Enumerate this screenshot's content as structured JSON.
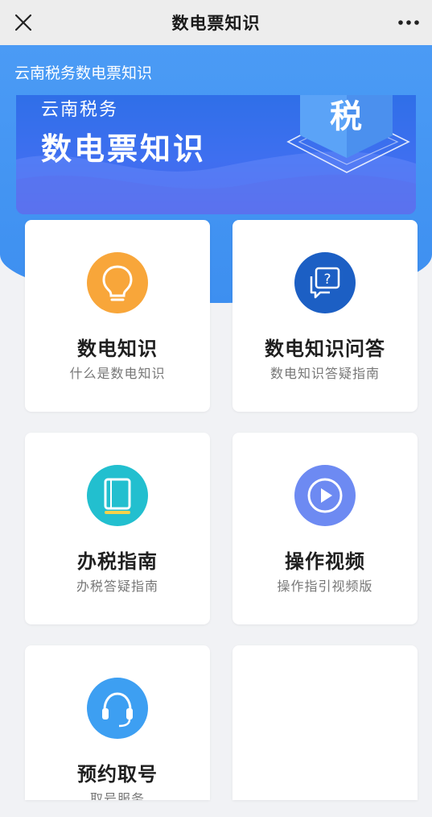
{
  "titlebar": {
    "title": "数电票知识"
  },
  "hero": {
    "heading": "云南税务数电票知识"
  },
  "banner": {
    "subtitle": "云南税务",
    "title": "数电票知识",
    "emblem_text": "税"
  },
  "cards": [
    {
      "title": "数电知识",
      "subtitle": "什么是数电知识",
      "icon": "lightbulb-icon",
      "color": "#f8a63a"
    },
    {
      "title": "数电知识问答",
      "subtitle": "数电知识答疑指南",
      "icon": "question-chat-icon",
      "color": "#1c5fc4"
    },
    {
      "title": "办税指南",
      "subtitle": "办税答疑指南",
      "icon": "book-icon",
      "color": "#22bfcf"
    },
    {
      "title": "操作视频",
      "subtitle": "操作指引视频版",
      "icon": "play-icon",
      "color": "#6d8af2"
    },
    {
      "title": "预约取号",
      "subtitle": "取号服务",
      "icon": "headset-icon",
      "color": "#3d9ff2"
    }
  ]
}
